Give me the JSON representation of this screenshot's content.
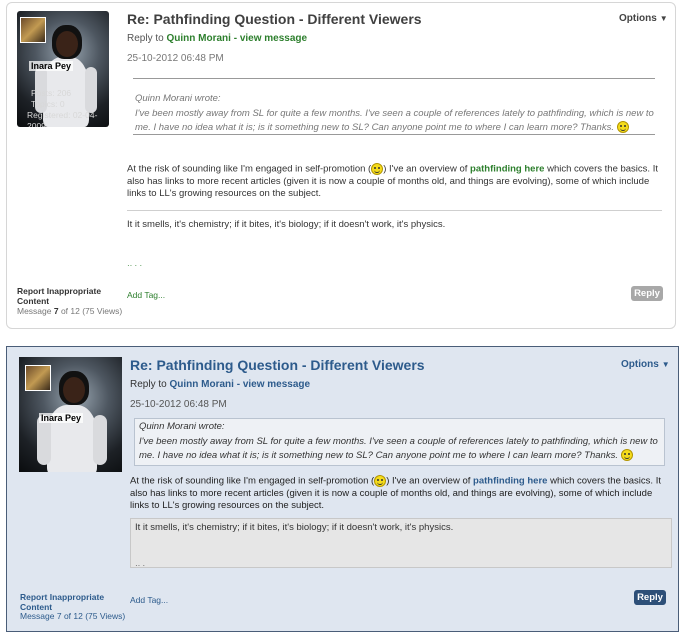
{
  "colors": {
    "panel_a_title": "#404040",
    "panel_a_link": "#2d7f2d",
    "panel_b_title": "#2d5b8c",
    "panel_b_link": "#2d5b8c",
    "panel_a_reply_btn": "#a8a8a8",
    "panel_b_reply_btn": "#2d4f78"
  },
  "panel_a": {
    "title": "Re: Pathfinding Question - Different Viewers",
    "options_label": "Options",
    "reply_to_prefix": "Reply to",
    "reply_to_user": "Quinn Morani",
    "reply_to_sep": " - ",
    "view_message": "view message",
    "date": "25-10-2012 06:48 PM",
    "avatar_name": "Inara Pey",
    "posts": "Posts: 206",
    "topics": "Topics: 0",
    "registered": "Registered: 02-04-2009",
    "quote_author": "Quinn Morani wrote:",
    "quote_text": "I've been mostly away from SL for quite a few months. I've seen a couple of references lately to pathfinding, which is new to me. I have no idea what it is; is it something new to SL? Can anyone point me to where I can learn more? Thanks.",
    "body_part1": "At the risk of sounding like I'm engaged in self-promotion (",
    "body_part2": ") I've an overview of ",
    "body_link": "pathfinding here",
    "body_part3": " which covers the basics. It also has links to more recent articles (given it is now a couple of months old, and things are evolving), some of which include links to LL's growing resources on the subject.",
    "signature": "It it smells, it's chemistry; if it bites, it's biology; if it doesn't work, it's physics.",
    "report_label": "Report Inappropriate Content",
    "message_prefix": "Message ",
    "message_num": "7",
    "message_suffix": " of 12 (75 Views)",
    "add_tag": "Add Tag...",
    "reply_button": "Reply"
  },
  "panel_b": {
    "title": "Re: Pathfinding Question - Different Viewers",
    "options_label": "Options",
    "reply_to_prefix": "Reply to",
    "reply_to_user": "Quinn Morani",
    "reply_to_sep": " - ",
    "view_message": "view message",
    "date": "25-10-2012 06:48 PM",
    "avatar_name": "Inara Pey",
    "quote_author": "Quinn Morani wrote:",
    "quote_text": "I've been mostly away from SL for quite a few months. I've seen a couple of references lately to pathfinding, which is new to me. I have no idea what it is; is it something new to SL? Can anyone point me to where I can learn more? Thanks.",
    "body_part1": "At the risk of sounding like I'm engaged in self-promotion (",
    "body_part2": ") I've an overview of ",
    "body_link": "pathfinding here",
    "body_part3": " which covers the basics. It also has links to more recent articles (given it is now a couple of months old, and things are evolving), some of which include links to LL's growing resources on the subject.",
    "signature": "It it smells, it's chemistry; if it bites, it's biology; if it doesn't work, it's physics.",
    "report_label": "Report Inappropriate Content",
    "message_prefix": "Message ",
    "message_num": "7",
    "message_suffix": " of 12 (75 Views)",
    "add_tag": "Add Tag...",
    "reply_button": "Reply"
  }
}
